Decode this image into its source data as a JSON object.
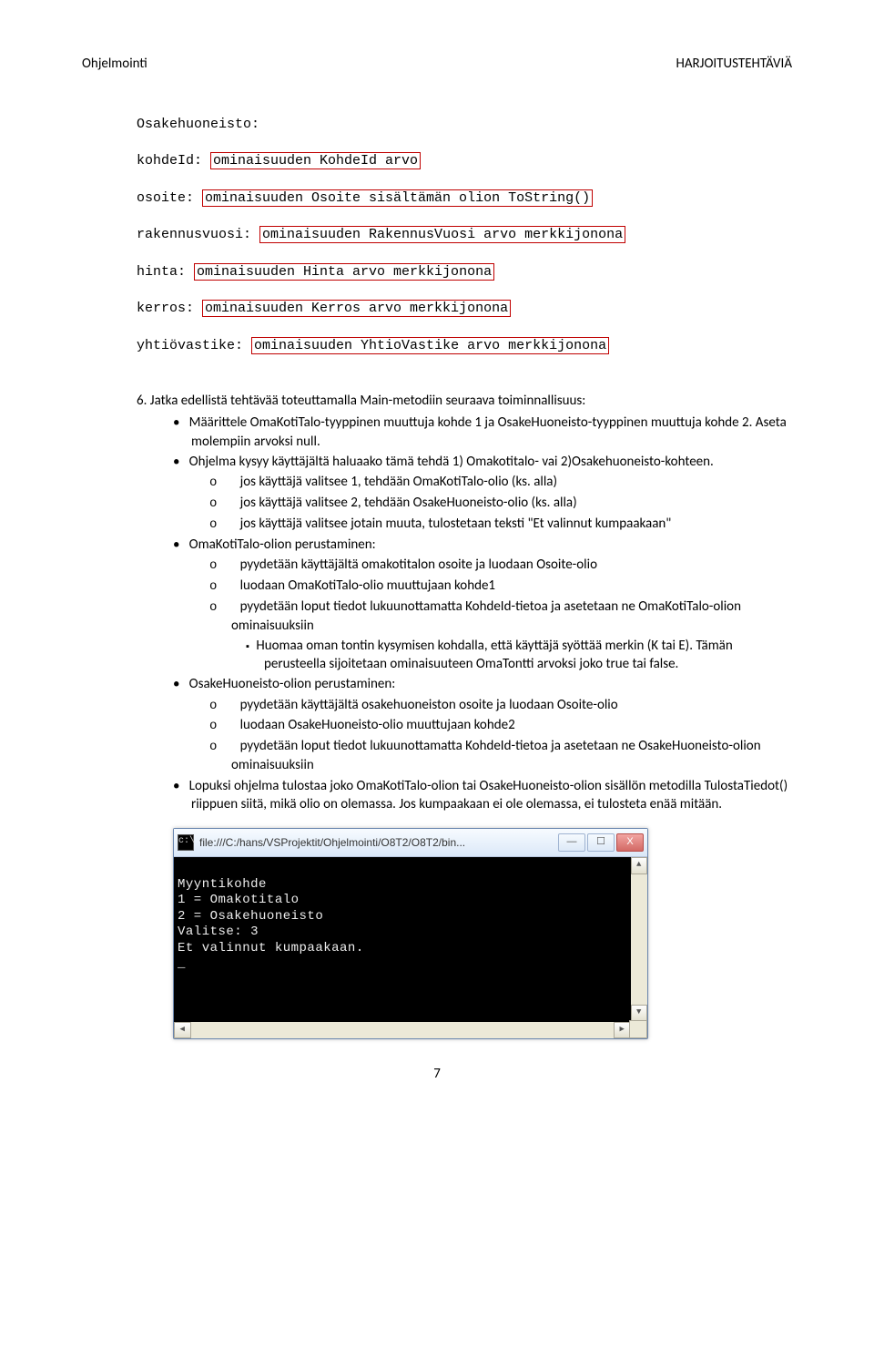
{
  "header": {
    "left": "Ohjelmointi",
    "right": "HARJOITUSTEHTÄVIÄ"
  },
  "code": {
    "l1": "Osakehuoneisto:",
    "l2a": "kohdeId: ",
    "l2b": "ominaisuuden KohdeId arvo",
    "l3a": "osoite: ",
    "l3b": "ominaisuuden Osoite sisältämän olion ToString()",
    "l4a": "rakennusvuosi: ",
    "l4b": "ominaisuuden RakennusVuosi arvo merkkijonona",
    "l5a": "hinta: ",
    "l5b": "ominaisuuden Hinta arvo merkkijonona",
    "l6a": "kerros: ",
    "l6b": "ominaisuuden Kerros arvo merkkijonona",
    "l7a": "yhtiövastike: ",
    "l7b": "ominaisuuden YhtioVastike arvo merkkijonona"
  },
  "task": {
    "num": "6. Jatka edellistä tehtävää toteuttamalla Main-metodiin seuraava toiminnallisuus:",
    "b1": "Määrittele OmaKotiTalo-tyyppinen muuttuja kohde 1 ja OsakeHuoneisto-tyyppinen muuttuja kohde 2. Aseta molempiin arvoksi null.",
    "b2": "Ohjelma kysyy käyttäjältä haluaako tämä tehdä 1) Omakotitalo- vai 2)Osakehuoneisto-kohteen.",
    "b2o1": "jos käyttäjä valitsee 1, tehdään OmaKotiTalo-olio (ks. alla)",
    "b2o2": "jos käyttäjä valitsee 2, tehdään OsakeHuoneisto-olio (ks. alla)",
    "b2o3": "jos käyttäjä valitsee jotain muuta, tulostetaan teksti \"Et valinnut kumpaakaan\"",
    "b3": "OmaKotiTalo-olion perustaminen:",
    "b3o1": "pyydetään käyttäjältä omakotitalon osoite ja luodaan Osoite-olio",
    "b3o2": "luodaan OmaKotiTalo-olio muuttujaan kohde1",
    "b3o3": "pyydetään loput tiedot lukuunottamatta KohdeId-tietoa ja asetetaan ne OmaKotiTalo-olion ominaisuuksiin",
    "b3s1": "Huomaa oman tontin kysymisen kohdalla, että käyttäjä syöttää merkin (K tai E). Tämän perusteella sijoitetaan ominaisuuteen OmaTontti arvoksi joko true tai false.",
    "b4": "OsakeHuoneisto-olion perustaminen:",
    "b4o1": "pyydetään käyttäjältä osakehuoneiston osoite ja luodaan Osoite-olio",
    "b4o2": "luodaan OsakeHuoneisto-olio muuttujaan kohde2",
    "b4o3": "pyydetään loput tiedot lukuunottamatta KohdeId-tietoa ja asetetaan ne OsakeHuoneisto-olion ominaisuuksiin",
    "b5": "Lopuksi ohjelma tulostaa joko OmaKotiTalo-olion tai OsakeHuoneisto-olion sisällön metodilla TulostaTiedot() riippuen siitä, mikä olio on olemassa. Jos kumpaakaan ei ole olemassa, ei tulosteta enää mitään."
  },
  "cmd": {
    "title": "file:///C:/hans/VSProjektit/Ohjelmointi/O8T2/O8T2/bin...",
    "l1": "Myyntikohde",
    "l2": "1 = Omakotitalo",
    "l3": "2 = Osakehuoneisto",
    "l4": "Valitse: 3",
    "l5": "Et valinnut kumpaakaan.",
    "l6": "_",
    "min": "—",
    "max": "☐",
    "close": "X",
    "up": "▲",
    "down": "▼",
    "left": "◀",
    "right": "▶"
  },
  "page": "7"
}
